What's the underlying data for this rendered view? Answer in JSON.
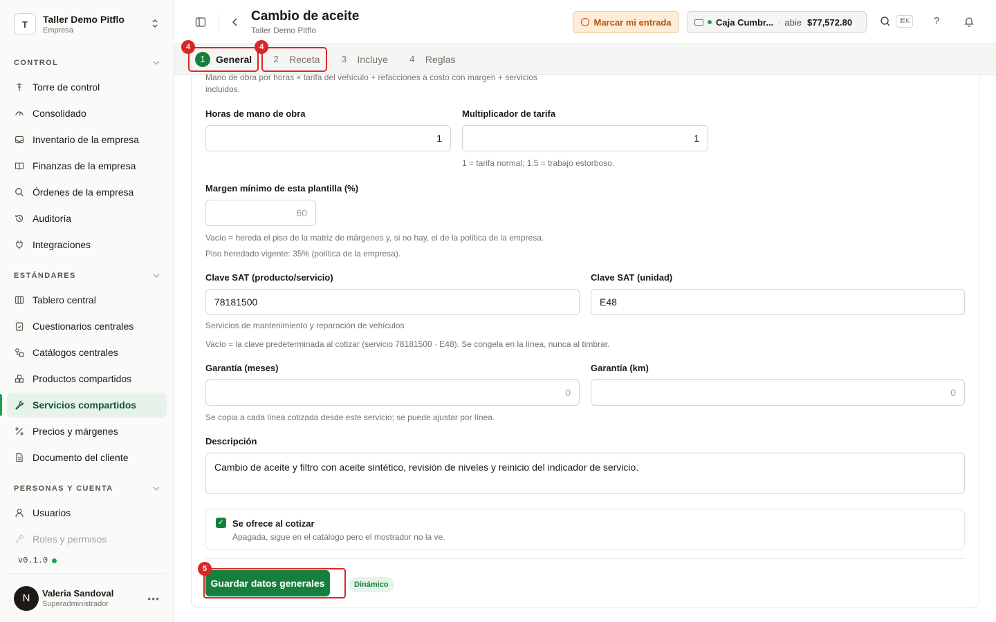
{
  "org": {
    "initial": "T",
    "name": "Taller Demo Pitflo",
    "type": "Empresa"
  },
  "sidebar": {
    "sections": [
      {
        "title": "CONTROL",
        "items": [
          "Torre de control",
          "Consolidado",
          "Inventario de la empresa",
          "Finanzas de la empresa",
          "Órdenes de la empresa",
          "Auditoría",
          "Integraciones"
        ]
      },
      {
        "title": "ESTÁNDARES",
        "items": [
          "Tablero central",
          "Cuestionarios centrales",
          "Catálogos centrales",
          "Productos compartidos",
          "Servicios compartidos",
          "Precios y márgenes",
          "Documento del cliente"
        ]
      },
      {
        "title": "PERSONAS Y CUENTA",
        "items": [
          "Usuarios",
          "Roles y permisos"
        ]
      }
    ],
    "version": "v0.1.0",
    "user": {
      "initial": "N",
      "name": "Valeria Sandoval",
      "role": "Superadministrador"
    }
  },
  "header": {
    "title": "Cambio de aceite",
    "subtitle": "Taller Demo Pitflo",
    "entry_button": "Marcar mi entrada",
    "caja": {
      "name": "Caja Cumbr...",
      "sep": "·",
      "state": "abie",
      "amount": "$77,572.80"
    },
    "shortcut": "⌘K",
    "help": "?"
  },
  "tabs": [
    {
      "num": "1",
      "label": "General",
      "badge": "4"
    },
    {
      "num": "2",
      "label": "Receta",
      "badge": "4"
    },
    {
      "num": "3",
      "label": "Incluye"
    },
    {
      "num": "4",
      "label": "Reglas"
    }
  ],
  "form": {
    "intro_line1": "Mano de obra por horas × tarifa del vehículo + refacciones a costo con margen + servicios",
    "intro_line2": "incluidos.",
    "hours": {
      "label": "Horas de mano de obra",
      "value": "1"
    },
    "multiplier": {
      "label": "Multiplicador de tarifa",
      "value": "1",
      "help": "1 = tarifa normal; 1.5 = trabajo estorboso."
    },
    "margin": {
      "label": "Margen mínimo de esta plantilla (%)",
      "placeholder": "60",
      "help1": "Vacío = hereda el piso de la matriz de márgenes y, si no hay, el de la política de la empresa.",
      "help2": "Piso heredado vigente: 35% (política de la empresa)."
    },
    "sat_product": {
      "label": "Clave SAT (producto/servicio)",
      "value": "78181500",
      "help": "Servicios de mantenimiento y reparación de vehículos"
    },
    "sat_unit": {
      "label": "Clave SAT (unidad)",
      "value": "E48"
    },
    "sat_help": "Vacío = la clave predeterminada al cotizar (servicio 78181500 · E48). Se congela en la línea, nunca al timbrar.",
    "warranty_months": {
      "label": "Garantía (meses)",
      "placeholder": "0"
    },
    "warranty_km": {
      "label": "Garantía (km)",
      "placeholder": "0"
    },
    "warranty_help": "Se copia a cada línea cotizada desde este servicio; se puede ajustar por línea.",
    "description": {
      "label": "Descripción",
      "value": "Cambio de aceite y filtro con aceite sintético, revisión de niveles y reinicio del indicador de servicio."
    },
    "offered": {
      "label": "Se ofrece al cotizar",
      "help": "Apagada, sigue en el catálogo pero el mostrador no la ve.",
      "checked": true
    },
    "save_label": "Guardar datos generales",
    "save_badge": "5",
    "dynamic_label": "Dinámico"
  }
}
